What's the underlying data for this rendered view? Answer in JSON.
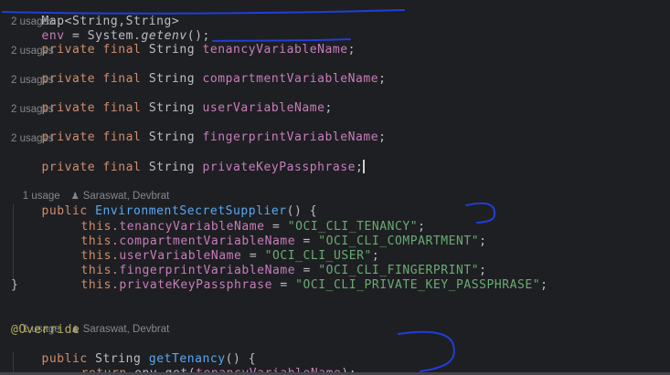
{
  "code": {
    "env_line": {
      "type": "Map<String,String>",
      "var": "env",
      "eq": " = ",
      "cls": "System.",
      "method": "getenv",
      "tail": "();"
    },
    "usages_label": "2 usages",
    "modifiers": "private final",
    "string_type": "String",
    "fields": [
      "tenancyVariableName",
      "compartmentVariableName",
      "userVariableName",
      "fingerprintVariableName",
      "privateKeyPassphrase"
    ],
    "semicolon": ";",
    "constructor_hint": {
      "usages": "1 usage",
      "author": "Saraswat, Devbrat"
    },
    "constructor": {
      "modifier": "public",
      "name": "EnvironmentSecretSupplier",
      "params": "() {",
      "close": "}"
    },
    "this_prefix": "this.",
    "assign_eq": " = ",
    "assignments": [
      {
        "field": "tenancyVariableName",
        "value": "\"OCI_CLI_TENANCY\""
      },
      {
        "field": "compartmentVariableName",
        "value": "\"OCI_CLI_COMPARTMENT\""
      },
      {
        "field": "userVariableName",
        "value": "\"OCI_CLI_USER\""
      },
      {
        "field": "fingerprintVariableName",
        "value": "\"OCI_CLI_FINGERPRINT\""
      },
      {
        "field": "privateKeyPassphrase",
        "value": "\"OCI_CLI_PRIVATE_KEY_PASSPHRASE\""
      }
    ],
    "method_hint": {
      "usages": "1 usage",
      "author": "Saraswat, Devbrat"
    },
    "annotation": "@Override",
    "method": {
      "modifier": "public",
      "return_type": "String",
      "name": "getTenancy",
      "params": "() {"
    },
    "return_line": {
      "keyword": "return",
      "call": " env.get(",
      "arg": "tenancyVariableName",
      "tail": ");"
    }
  },
  "icons": {
    "author": "person-icon"
  },
  "colors": {
    "background": "#1e1f22",
    "keyword": "#cf8e6d",
    "field": "#c77dbb",
    "string": "#6aab73",
    "method": "#56a8f5",
    "annotation": "#b3ae60",
    "ink": "#1f3fd8"
  }
}
